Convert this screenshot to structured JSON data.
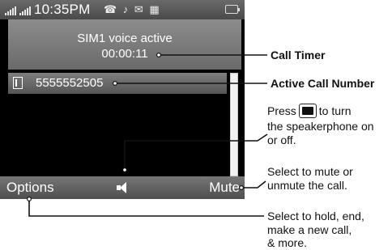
{
  "status_bar": {
    "time": "10:35PM",
    "icons": "☎ ♪ ✉ ▦"
  },
  "call": {
    "state": "SIM1 voice active",
    "timer": "00:00:11",
    "number": "5555552505"
  },
  "softkeys": {
    "left": "Options",
    "right": "Mute"
  },
  "annotations": {
    "call_timer": "Call Timer",
    "active_number": "Active Call Number",
    "speaker_prefix": "Press",
    "speaker_suffix_1": "to turn",
    "speaker_line_2": "the speakerphone on",
    "speaker_line_3": "or off.",
    "mute_line_1": "Select to mute or",
    "mute_line_2": "unmute the call.",
    "options_line_1": "Select to hold, end,",
    "options_line_2": "make a new call,",
    "options_line_3": "& more."
  },
  "icons": {
    "signal_1": "signal-bars-icon",
    "signal_2": "signal-bars-icon",
    "battery": "battery-icon",
    "sim": "sim-card-icon",
    "speaker": "speakerphone-icon",
    "key": "center-key-icon"
  },
  "colors": {
    "screen_bg": "#000000",
    "panel_gray": "#7a7a7a"
  }
}
